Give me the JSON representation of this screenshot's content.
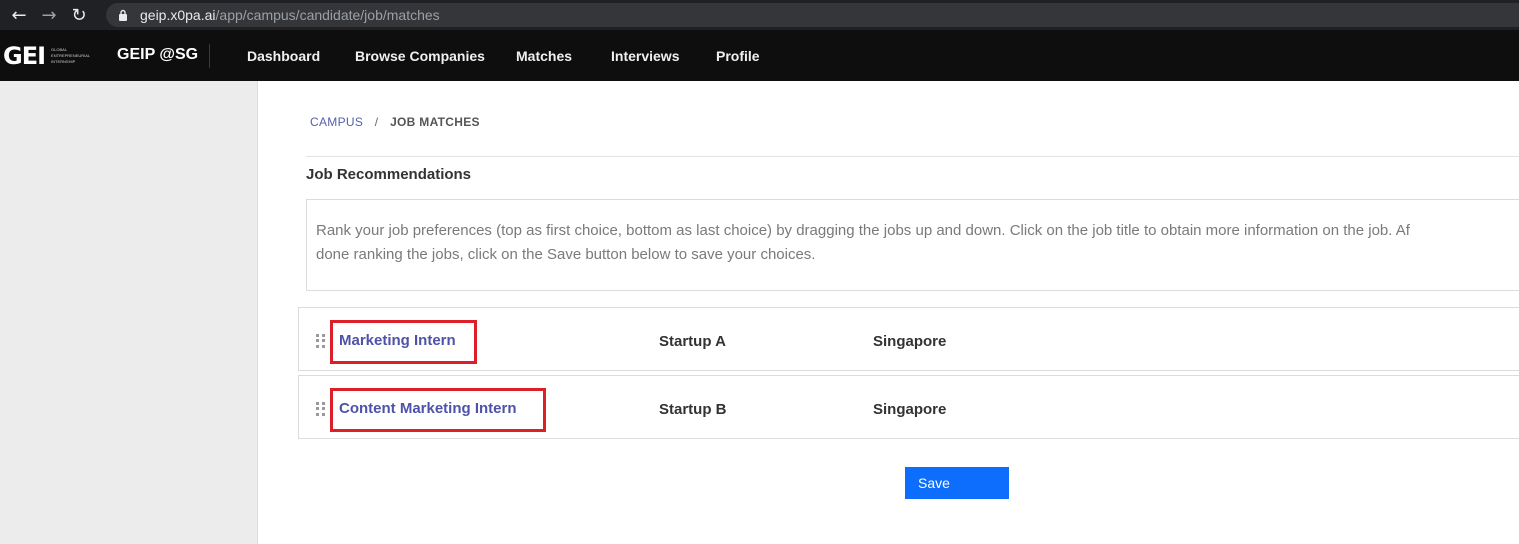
{
  "browser": {
    "back_icon": "←",
    "forward_icon": "→",
    "reload_icon": "↻",
    "url_host": "geip.x0pa.ai",
    "url_path": "/app/campus/candidate/job/matches"
  },
  "navbar": {
    "logo_mark": "GEI",
    "logo_text_lines": [
      "Global",
      "Entrepreneurial",
      "Internship"
    ],
    "brand": "GEIP @SG",
    "links": [
      "Dashboard",
      "Browse Companies",
      "Matches",
      "Interviews",
      "Profile"
    ]
  },
  "breadcrumb": {
    "root": "CAMPUS",
    "separator": "/",
    "current": "JOB MATCHES"
  },
  "section": {
    "title": "Job Recommendations",
    "instructions_line1": "Rank your job preferences (top as first choice, bottom as last choice) by dragging the jobs up and down. Click on the job title to obtain more information on the job. Af",
    "instructions_line2": "done ranking the jobs, click on the Save button below to save your choices."
  },
  "jobs": [
    {
      "title": "Marketing Intern",
      "company": "Startup A",
      "location": "Singapore"
    },
    {
      "title": "Content Marketing Intern",
      "company": "Startup B",
      "location": "Singapore"
    }
  ],
  "actions": {
    "save_label": "Save"
  },
  "colors": {
    "accent": "#0d6efd",
    "link": "#4e52a8",
    "highlight_box": "#dd1f2a",
    "navbar_bg": "#0e0e0e"
  }
}
